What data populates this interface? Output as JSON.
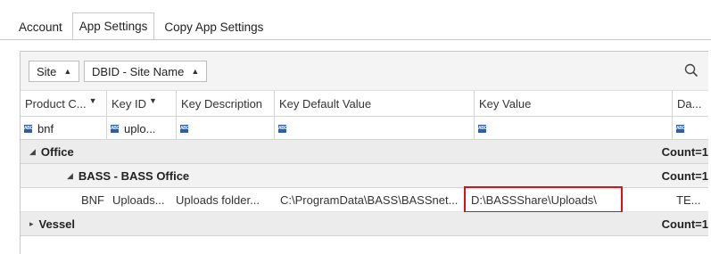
{
  "tabs": [
    {
      "label": "Account"
    },
    {
      "label": "App Settings"
    },
    {
      "label": "Copy App Settings"
    }
  ],
  "grouping": {
    "chips": [
      {
        "label": "Site"
      },
      {
        "label": "DBID - Site Name"
      }
    ]
  },
  "columns": [
    {
      "label": "Product C...",
      "filter": true
    },
    {
      "label": "Key ID",
      "filter": true
    },
    {
      "label": "Key Description",
      "filter": false
    },
    {
      "label": "Key Default Value",
      "filter": false
    },
    {
      "label": "Key Value",
      "filter": false
    },
    {
      "label": "Da...",
      "filter": false
    }
  ],
  "filter_row": {
    "product_code": "bnf",
    "key_id": "uplo...",
    "type_badge": "ABC",
    "type_badge_small": "ABC"
  },
  "groups": {
    "office": {
      "label": "Office",
      "count": "Count=1"
    },
    "bass": {
      "label": "BASS - BASS Office",
      "count": "Count=1"
    },
    "vessel": {
      "label": "Vessel",
      "count": "Count=1"
    }
  },
  "data_row": {
    "product_code": "BNF",
    "key_id": "Uploads...",
    "key_description": "Uploads folder...",
    "key_default_value": "C:\\ProgramData\\BASS\\BASSnet...",
    "key_value": "D:\\BASSShare\\Uploads\\",
    "data": "TE..."
  },
  "colors": {
    "highlight": "#e01010",
    "badge": "#2a5ea8"
  }
}
